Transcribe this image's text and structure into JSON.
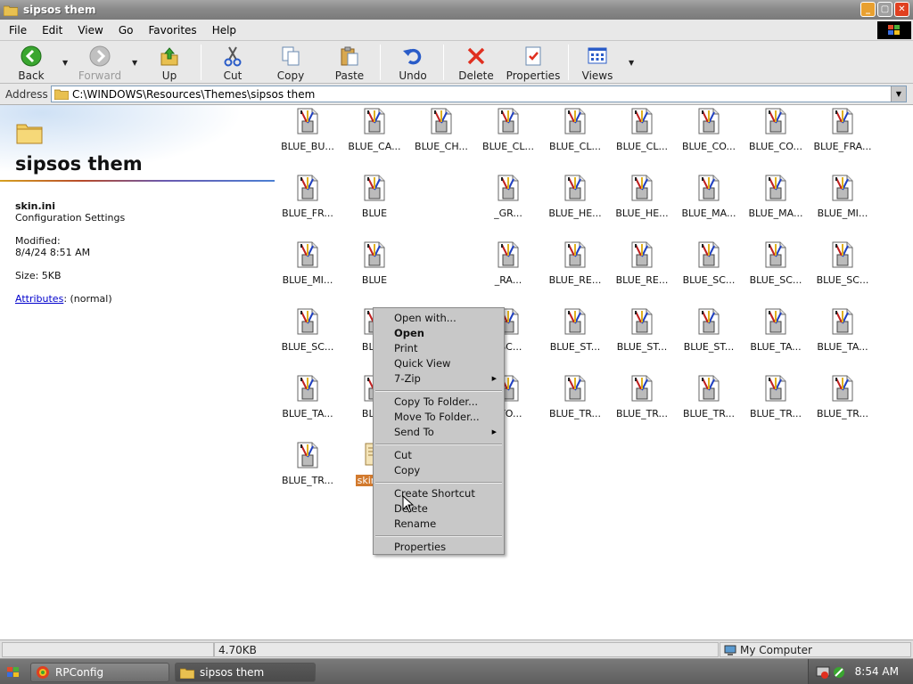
{
  "window": {
    "title": "sipsos them"
  },
  "menubar": {
    "items": [
      "File",
      "Edit",
      "View",
      "Go",
      "Favorites",
      "Help"
    ]
  },
  "toolbar": {
    "back": "Back",
    "forward": "Forward",
    "up": "Up",
    "cut": "Cut",
    "copy": "Copy",
    "paste": "Paste",
    "undo": "Undo",
    "delete": "Delete",
    "properties": "Properties",
    "views": "Views"
  },
  "address": {
    "label": "Address",
    "path": "C:\\WINDOWS\\Resources\\Themes\\sipsos them"
  },
  "leftpanel": {
    "folder_title": "sipsos them",
    "file_name": "skin.ini",
    "file_type": "Configuration Settings",
    "modified_label": "Modified:",
    "modified_value": "8/4/24 8:51 AM",
    "size": "Size: 5KB",
    "attributes_link": "Attributes",
    "attributes_value": ": (normal)"
  },
  "files": [
    "BLUE_BU...",
    "BLUE_CA...",
    "BLUE_CH...",
    "BLUE_CL...",
    "BLUE_CL...",
    "BLUE_CL...",
    "BLUE_CO...",
    "BLUE_CO...",
    "BLUE_FRA...",
    "BLUE_FR...",
    "BLUE",
    "",
    "_GR...",
    "BLUE_HE...",
    "BLUE_HE...",
    "BLUE_MA...",
    "BLUE_MA...",
    "BLUE_MI...",
    "BLUE_MI...",
    "BLUE",
    "",
    "_RA...",
    "BLUE_RE...",
    "BLUE_RE...",
    "BLUE_SC...",
    "BLUE_SC...",
    "BLUE_SC...",
    "BLUE_SC...",
    "BLUE",
    "",
    "_SC...",
    "BLUE_ST...",
    "BLUE_ST...",
    "BLUE_ST...",
    "BLUE_TA...",
    "BLUE_TA...",
    "BLUE_TA...",
    "BLUE",
    "",
    "_TO...",
    "BLUE_TR...",
    "BLUE_TR...",
    "BLUE_TR...",
    "BLUE_TR...",
    "BLUE_TR...",
    "BLUE_TR...",
    "skin.ini"
  ],
  "context_menu": {
    "items": [
      {
        "label": "Open with...",
        "bold": false
      },
      {
        "label": "Open",
        "bold": true
      },
      {
        "label": "Print",
        "bold": false
      },
      {
        "label": "Quick View",
        "bold": false
      },
      {
        "label": "7-Zip",
        "bold": false,
        "submenu": true
      },
      {
        "sep": true
      },
      {
        "label": "Copy To Folder...",
        "bold": false
      },
      {
        "label": "Move To Folder...",
        "bold": false
      },
      {
        "label": "Send To",
        "bold": false,
        "submenu": true
      },
      {
        "sep": true
      },
      {
        "label": "Cut",
        "bold": false
      },
      {
        "label": "Copy",
        "bold": false
      },
      {
        "sep": true
      },
      {
        "label": "Create Shortcut",
        "bold": false
      },
      {
        "label": "Delete",
        "bold": false
      },
      {
        "label": "Rename",
        "bold": false
      },
      {
        "sep": true
      },
      {
        "label": "Properties",
        "bold": false
      }
    ]
  },
  "statusbar": {
    "size": "4.70KB",
    "zone": "My Computer"
  },
  "taskbar": {
    "tasks": [
      "RPConfig",
      "sipsos them"
    ],
    "clock": "8:54 AM"
  },
  "colors": {
    "selection": "#d27a2e",
    "link": "#0000cc"
  }
}
